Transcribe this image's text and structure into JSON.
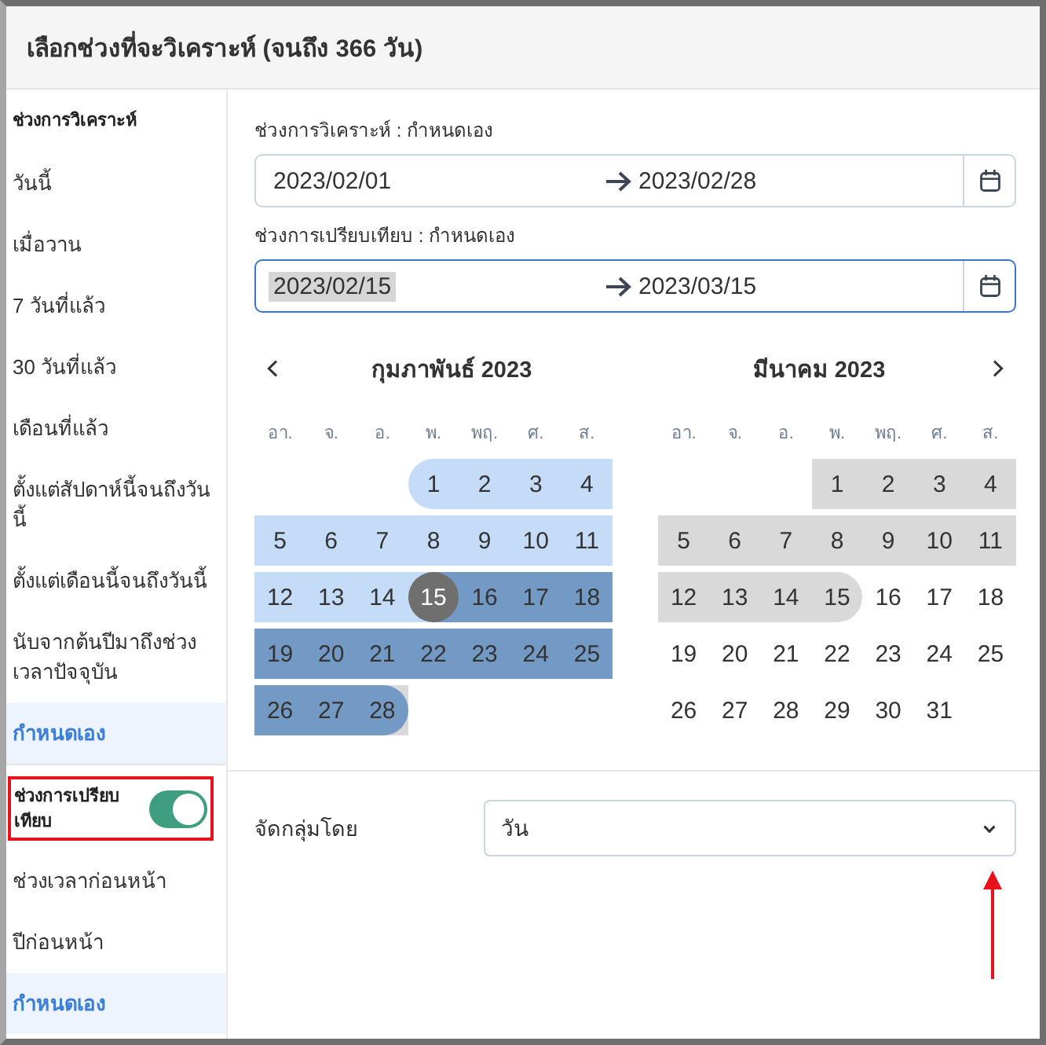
{
  "dialog": {
    "title": "เลือกช่วงที่จะวิเคราะห์ (จนถึง 366 วัน)"
  },
  "sidebar": {
    "sections": [
      {
        "heading": "ช่วงการวิเคราะห์",
        "items": [
          {
            "label": "วันนี้",
            "selected": false
          },
          {
            "label": "เมื่อวาน",
            "selected": false
          },
          {
            "label": "7 วันที่แล้ว",
            "selected": false
          },
          {
            "label": "30 วันที่แล้ว",
            "selected": false
          },
          {
            "label": "เดือนที่แล้ว",
            "selected": false
          },
          {
            "label": "ตั้งแต่สัปดาห์นี้จนถึงวันนี้",
            "selected": false
          },
          {
            "label": "ตั้งแต่เดือนนี้จนถึงวันนี้",
            "selected": false
          },
          {
            "label": "นับจากต้นปีมาถึงช่วงเวลาปัจจุบัน",
            "selected": false
          },
          {
            "label": "กำหนดเอง",
            "selected": true
          }
        ]
      },
      {
        "heading": "ช่วงการเปรียบเทียบ",
        "toggle": {
          "on": true
        },
        "items": [
          {
            "label": "ช่วงเวลาก่อนหน้า",
            "selected": false
          },
          {
            "label": "ปีก่อนหน้า",
            "selected": false
          },
          {
            "label": "กำหนดเอง",
            "selected": true
          }
        ]
      }
    ]
  },
  "ranges": [
    {
      "label": "ช่วงการวิเคราะห์ : กำหนดเอง",
      "start": "2023/02/01",
      "end": "2023/02/28",
      "focused": false,
      "start_highlighted": false
    },
    {
      "label": "ช่วงการเปรียบเทียบ : กำหนดเอง",
      "start": "2023/02/15",
      "end": "2023/03/15",
      "focused": true,
      "start_highlighted": true
    }
  ],
  "calendars": [
    {
      "title": "กุมภาพันธ์ 2023",
      "weekdays": [
        "อา.",
        "จ.",
        "อ.",
        "พ.",
        "พฤ.",
        "ศ.",
        "ส."
      ],
      "weeks": [
        [
          {
            "kind": "blank"
          },
          {
            "kind": "blank"
          },
          {
            "kind": "blank"
          },
          {
            "kind": "day",
            "day": "1",
            "analysis": true,
            "compare": false,
            "selected": false
          },
          {
            "kind": "day",
            "day": "2",
            "analysis": true,
            "compare": false,
            "selected": false
          },
          {
            "kind": "day",
            "day": "3",
            "analysis": true,
            "compare": false,
            "selected": false
          },
          {
            "kind": "day",
            "day": "4",
            "analysis": true,
            "compare": false,
            "selected": false
          }
        ],
        [
          {
            "kind": "day",
            "day": "5",
            "analysis": true,
            "compare": false,
            "selected": false
          },
          {
            "kind": "day",
            "day": "6",
            "analysis": true,
            "compare": false,
            "selected": false
          },
          {
            "kind": "day",
            "day": "7",
            "analysis": true,
            "compare": false,
            "selected": false
          },
          {
            "kind": "day",
            "day": "8",
            "analysis": true,
            "compare": false,
            "selected": false
          },
          {
            "kind": "day",
            "day": "9",
            "analysis": true,
            "compare": false,
            "selected": false
          },
          {
            "kind": "day",
            "day": "10",
            "analysis": true,
            "compare": false,
            "selected": false
          },
          {
            "kind": "day",
            "day": "11",
            "analysis": true,
            "compare": false,
            "selected": false
          }
        ],
        [
          {
            "kind": "day",
            "day": "12",
            "analysis": true,
            "compare": false,
            "selected": false
          },
          {
            "kind": "day",
            "day": "13",
            "analysis": true,
            "compare": false,
            "selected": false
          },
          {
            "kind": "day",
            "day": "14",
            "analysis": true,
            "compare": false,
            "selected": false
          },
          {
            "kind": "day",
            "day": "15",
            "analysis": true,
            "compare": true,
            "selected": true
          },
          {
            "kind": "day",
            "day": "16",
            "analysis": true,
            "compare": true,
            "selected": false
          },
          {
            "kind": "day",
            "day": "17",
            "analysis": true,
            "compare": true,
            "selected": false
          },
          {
            "kind": "day",
            "day": "18",
            "analysis": true,
            "compare": true,
            "selected": false
          }
        ],
        [
          {
            "kind": "day",
            "day": "19",
            "analysis": true,
            "compare": true,
            "selected": false
          },
          {
            "kind": "day",
            "day": "20",
            "analysis": true,
            "compare": true,
            "selected": false
          },
          {
            "kind": "day",
            "day": "21",
            "analysis": true,
            "compare": true,
            "selected": false
          },
          {
            "kind": "day",
            "day": "22",
            "analysis": true,
            "compare": true,
            "selected": false
          },
          {
            "kind": "day",
            "day": "23",
            "analysis": true,
            "compare": true,
            "selected": false
          },
          {
            "kind": "day",
            "day": "24",
            "analysis": true,
            "compare": true,
            "selected": false
          },
          {
            "kind": "day",
            "day": "25",
            "analysis": true,
            "compare": true,
            "selected": false
          }
        ],
        [
          {
            "kind": "day",
            "day": "26",
            "analysis": true,
            "compare": true,
            "selected": false
          },
          {
            "kind": "day",
            "day": "27",
            "analysis": true,
            "compare": true,
            "selected": false
          },
          {
            "kind": "day",
            "day": "28",
            "analysis": true,
            "compare": true,
            "selected": false
          }
        ]
      ]
    },
    {
      "title": "มีนาคม 2023",
      "weekdays": [
        "อา.",
        "จ.",
        "อ.",
        "พ.",
        "พฤ.",
        "ศ.",
        "ส."
      ],
      "weeks": [
        [
          {
            "kind": "blank"
          },
          {
            "kind": "blank"
          },
          {
            "kind": "blank"
          },
          {
            "kind": "day",
            "day": "1",
            "analysis": false,
            "compare": true,
            "selected": false
          },
          {
            "kind": "day",
            "day": "2",
            "analysis": false,
            "compare": true,
            "selected": false
          },
          {
            "kind": "day",
            "day": "3",
            "analysis": false,
            "compare": true,
            "selected": false
          },
          {
            "kind": "day",
            "day": "4",
            "analysis": false,
            "compare": true,
            "selected": false
          }
        ],
        [
          {
            "kind": "day",
            "day": "5",
            "analysis": false,
            "compare": true,
            "selected": false
          },
          {
            "kind": "day",
            "day": "6",
            "analysis": false,
            "compare": true,
            "selected": false
          },
          {
            "kind": "day",
            "day": "7",
            "analysis": false,
            "compare": true,
            "selected": false
          },
          {
            "kind": "day",
            "day": "8",
            "analysis": false,
            "compare": true,
            "selected": false
          },
          {
            "kind": "day",
            "day": "9",
            "analysis": false,
            "compare": true,
            "selected": false
          },
          {
            "kind": "day",
            "day": "10",
            "analysis": false,
            "compare": true,
            "selected": false
          },
          {
            "kind": "day",
            "day": "11",
            "analysis": false,
            "compare": true,
            "selected": false
          }
        ],
        [
          {
            "kind": "day",
            "day": "12",
            "analysis": false,
            "compare": true,
            "selected": false
          },
          {
            "kind": "day",
            "day": "13",
            "analysis": false,
            "compare": true,
            "selected": false
          },
          {
            "kind": "day",
            "day": "14",
            "analysis": false,
            "compare": true,
            "selected": false
          },
          {
            "kind": "day",
            "day": "15",
            "analysis": false,
            "compare": true,
            "selected": false
          },
          {
            "kind": "day",
            "day": "16",
            "analysis": false,
            "compare": false,
            "selected": false
          },
          {
            "kind": "day",
            "day": "17",
            "analysis": false,
            "compare": false,
            "selected": false
          },
          {
            "kind": "day",
            "day": "18",
            "analysis": false,
            "compare": false,
            "selected": false
          }
        ],
        [
          {
            "kind": "day",
            "day": "19",
            "analysis": false,
            "compare": false,
            "selected": false
          },
          {
            "kind": "day",
            "day": "20",
            "analysis": false,
            "compare": false,
            "selected": false
          },
          {
            "kind": "day",
            "day": "21",
            "analysis": false,
            "compare": false,
            "selected": false
          },
          {
            "kind": "day",
            "day": "22",
            "analysis": false,
            "compare": false,
            "selected": false
          },
          {
            "kind": "day",
            "day": "23",
            "analysis": false,
            "compare": false,
            "selected": false
          },
          {
            "kind": "day",
            "day": "24",
            "analysis": false,
            "compare": false,
            "selected": false
          },
          {
            "kind": "day",
            "day": "25",
            "analysis": false,
            "compare": false,
            "selected": false
          }
        ],
        [
          {
            "kind": "day",
            "day": "26",
            "analysis": false,
            "compare": false,
            "selected": false
          },
          {
            "kind": "day",
            "day": "27",
            "analysis": false,
            "compare": false,
            "selected": false
          },
          {
            "kind": "day",
            "day": "28",
            "analysis": false,
            "compare": false,
            "selected": false
          },
          {
            "kind": "day",
            "day": "29",
            "analysis": false,
            "compare": false,
            "selected": false
          },
          {
            "kind": "day",
            "day": "30",
            "analysis": false,
            "compare": false,
            "selected": false
          },
          {
            "kind": "day",
            "day": "31",
            "analysis": false,
            "compare": false,
            "selected": false
          }
        ]
      ]
    }
  ],
  "group_by": {
    "label": "จัดกลุ่มโดย",
    "value": "วัน"
  },
  "annotations": [
    {
      "kind": "box"
    },
    {
      "kind": "arrow"
    }
  ]
}
